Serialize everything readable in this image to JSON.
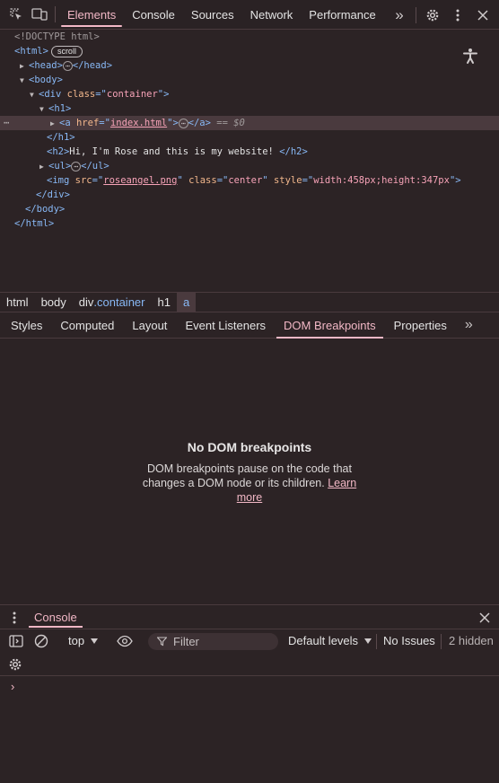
{
  "topbar": {
    "tabs": [
      "Elements",
      "Console",
      "Sources",
      "Network",
      "Performance"
    ],
    "active_tab": "Elements",
    "more_glyph": "»",
    "icons": [
      "inspect-icon",
      "device-toolbar-icon",
      "settings-gear-icon",
      "more-vert-icon",
      "close-icon"
    ]
  },
  "dom": {
    "doctype": "<!DOCTYPE html>",
    "html_open": "<html>",
    "scroll_badge": "scroll",
    "head_open": "<head>",
    "head_close": "</head>",
    "body_open": "<body>",
    "div_tag": "div",
    "div_attr": "class",
    "div_val": "container",
    "h1_open": "<h1>",
    "a_tag": "a",
    "a_attr": "href",
    "a_val": "index.html",
    "a_close": "</a>",
    "a_eq": "== $0",
    "h1_close": "</h1>",
    "h2_open": "<h2>",
    "h2_text": "Hi, I'm Rose and this is my website! ",
    "h2_close": "</h2>",
    "ul_open": "<ul>",
    "ul_close": "</ul>",
    "img_tag": "img",
    "img_src_attr": "src",
    "img_src_val": "roseangel.png",
    "img_class_attr": "class",
    "img_class_val": "center",
    "img_style_attr": "style",
    "img_style_val": "width:458px;height:347px",
    "div_close": "</div>",
    "body_close": "</body>",
    "html_close": "</html>",
    "ellipsis": "⋯",
    "dots": "⋯"
  },
  "breadcrumb": {
    "items": [
      "html",
      "body",
      "div",
      ".container",
      "h1",
      "a"
    ]
  },
  "panel_tabs": {
    "tabs": [
      "Styles",
      "Computed",
      "Layout",
      "Event Listeners",
      "DOM Breakpoints",
      "Properties"
    ],
    "active": "DOM Breakpoints",
    "more_glyph": "»"
  },
  "empty_state": {
    "title": "No DOM breakpoints",
    "description": "DOM breakpoints pause on the code that changes a DOM node or its children.",
    "link": "Learn more"
  },
  "console": {
    "drawer_tab": "Console",
    "context": "top",
    "filter_placeholder": "Filter",
    "levels": "Default levels",
    "issues": "No Issues",
    "hidden": "2 hidden",
    "prompt": "›"
  },
  "colors": {
    "background": "#2c2325",
    "accent": "#f2b8c6",
    "tag": "#88b8f5",
    "attr": "#f2b78c",
    "value": "#f6a2b7"
  }
}
